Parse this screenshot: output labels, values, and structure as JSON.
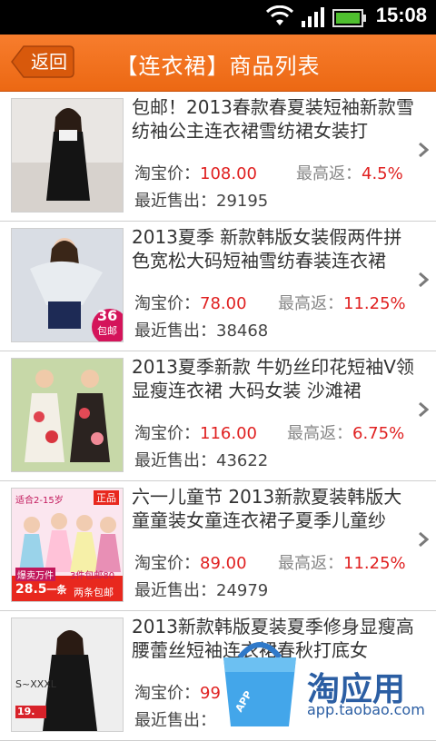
{
  "status": {
    "time": "15:08"
  },
  "header": {
    "back_label": "返回",
    "title": "【连衣裙】商品列表"
  },
  "labels": {
    "price": "淘宝价：",
    "rebate": "最高返：",
    "sold": "最近售出："
  },
  "items": [
    {
      "title": "包邮！2013春款春夏装短袖新款雪纺袖公主连衣裙雪纺裙女装打",
      "price": "108.00",
      "rebate": "4.5%",
      "sold": "29195"
    },
    {
      "title": "2013夏季 新款韩版女装假两件拼色宽松大码短袖雪纺春装连衣裙",
      "price": "78.00",
      "rebate": "11.25%",
      "sold": "38468",
      "badge_num": "36",
      "badge_text": "包邮"
    },
    {
      "title": "2013夏季新款 牛奶丝印花短袖V领 显瘦连衣裙 大码女装 沙滩裙",
      "price": "116.00",
      "rebate": "6.75%",
      "sold": "43622"
    },
    {
      "title": "六一儿童节 2013新款夏装韩版大童童装女童连衣裙子夏季儿童纱",
      "price": "89.00",
      "rebate": "11.25%",
      "sold": "24979",
      "promo_top": "适合2-15岁",
      "promo_corner": "正品",
      "promo_mid": "爆卖万件",
      "promo_mid2": "3件包邮80",
      "promo_price": "28.5",
      "promo_unit": "一条",
      "promo_tail": "两条包邮"
    },
    {
      "title": "2013新款韩版夏装夏季修身显瘦高腰蕾丝短袖连衣裙春秋打底女",
      "price": "99",
      "sold": "",
      "promo_size": "S~XXXL",
      "promo_price": "19."
    }
  ],
  "watermark": {
    "text": "淘应用",
    "url": "app.taobao.com",
    "badge": "APP"
  }
}
